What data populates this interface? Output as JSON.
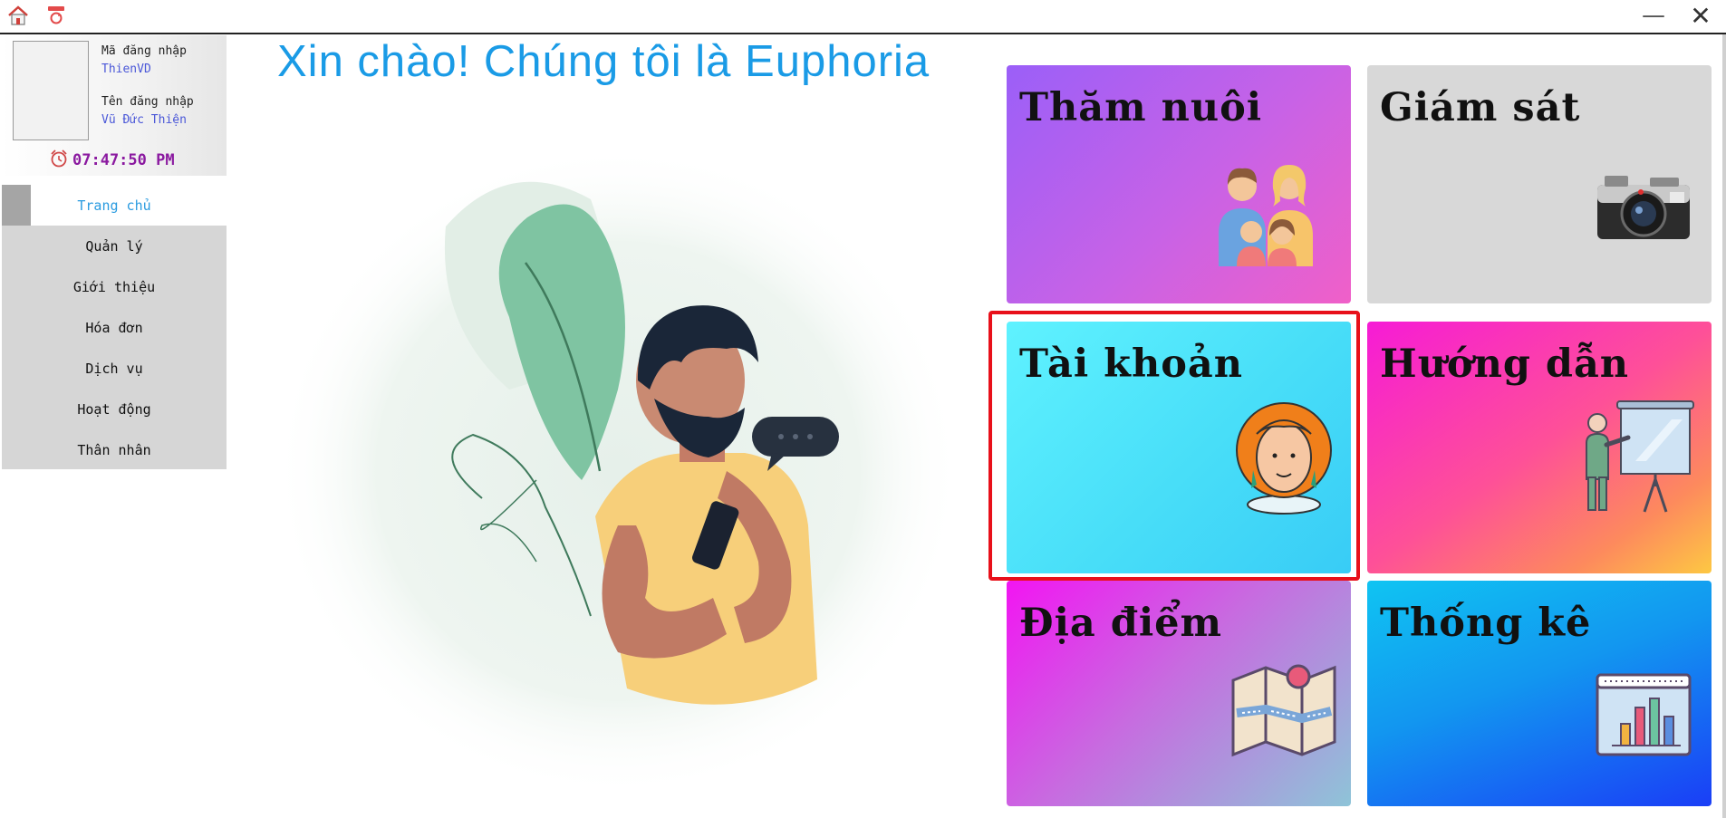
{
  "window": {
    "home_icon": "home-icon",
    "refresh_icon": "refresh-icon",
    "minimize_symbol": "—",
    "close_symbol": "✕"
  },
  "user": {
    "login_code_label": "Mã đăng nhập",
    "login_code": "ThienVD",
    "login_name_label": "Tên đăng nhập",
    "login_name": "Vũ Đức Thiện",
    "clock_icon": "alarm-clock-icon",
    "time": "07:47:50 PM"
  },
  "sidebar": {
    "items": [
      {
        "label": "Trang chủ",
        "active": true
      },
      {
        "label": "Quản lý"
      },
      {
        "label": "Giới thiệu"
      },
      {
        "label": "Hóa đơn"
      },
      {
        "label": "Dịch vụ"
      },
      {
        "label": "Hoạt động"
      },
      {
        "label": "Thân nhân"
      }
    ]
  },
  "main": {
    "greeting": "Xin chào! Chúng tôi là Euphoria",
    "illustration": "man-with-phone-illustration"
  },
  "tiles": {
    "foster": {
      "title": "Thăm nuôi",
      "icon": "family-icon"
    },
    "monitor": {
      "title": "Giám sát",
      "icon": "camera-icon"
    },
    "account": {
      "title": "Tài khoản",
      "icon": "user-portrait-icon",
      "highlighted": true
    },
    "guide": {
      "title": "Hướng dẫn",
      "icon": "presentation-icon"
    },
    "location": {
      "title": "Địa điểm",
      "icon": "map-icon"
    },
    "stats": {
      "title": "Thống kê",
      "icon": "bar-chart-icon"
    }
  },
  "colors": {
    "accent": "#1a9be6",
    "highlight": "#e8101a",
    "clock": "#8b1aa0"
  }
}
